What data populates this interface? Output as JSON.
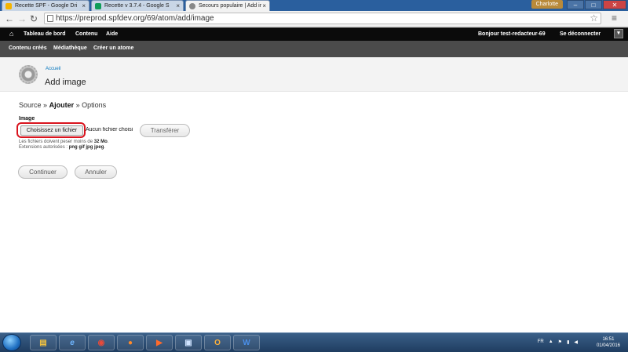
{
  "browser": {
    "tabs": [
      {
        "title": "Recette SPF - Google Dri",
        "fav_color": "#f4b400"
      },
      {
        "title": "Recette v 3.7.4 - Google S",
        "fav_color": "#0f9d58"
      },
      {
        "title": "Secours populaire | Add ir",
        "fav_color": "#888888"
      }
    ],
    "user_badge": "Charlotte",
    "url": "https://preprod.spfdev.org/69/atom/add/image"
  },
  "admin_bar": {
    "items": [
      "Tableau de bord",
      "Contenu",
      "Aide"
    ],
    "greeting_prefix": "Bonjour",
    "username": "test-redacteur-69",
    "logout": "Se déconnecter"
  },
  "shortcuts": [
    "Contenu créés",
    "Médiathèque",
    "Créer un atome"
  ],
  "header": {
    "breadcrumb": "Accueil",
    "title": "Add image"
  },
  "steps": {
    "first": "Source",
    "sep": "»",
    "current": "Ajouter",
    "last": "Options"
  },
  "form": {
    "field_label": "Image",
    "file_button": "Choisissez un fichier",
    "file_status": "Aucun fichier choisi",
    "upload_button": "Transférer",
    "help_size_prefix": "Les fichiers doivent peser moins de",
    "help_size_value": "32 Mo",
    "help_ext_prefix": "Extensions autorisées :",
    "help_ext_value": "png gif jpg jpeg",
    "continue_button": "Continuer",
    "cancel_button": "Annuler"
  },
  "taskbar": {
    "language": "FR",
    "time": "16:51",
    "date": "01/04/2016"
  },
  "colors": {
    "highlight": "#d9141e",
    "link": "#0074bd"
  }
}
